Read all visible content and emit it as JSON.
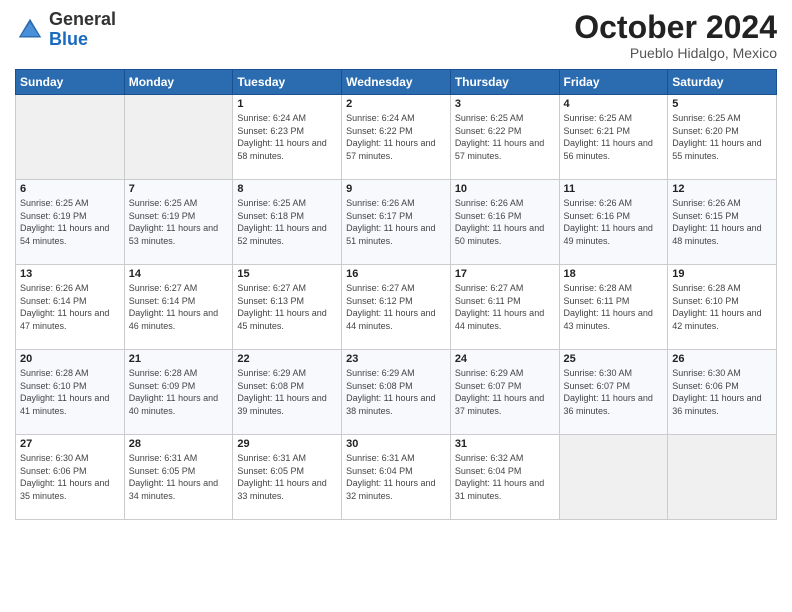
{
  "logo": {
    "general": "General",
    "blue": "Blue"
  },
  "header": {
    "month": "October 2024",
    "location": "Pueblo Hidalgo, Mexico"
  },
  "days_of_week": [
    "Sunday",
    "Monday",
    "Tuesday",
    "Wednesday",
    "Thursday",
    "Friday",
    "Saturday"
  ],
  "weeks": [
    [
      {
        "day": "",
        "info": ""
      },
      {
        "day": "",
        "info": ""
      },
      {
        "day": "1",
        "info": "Sunrise: 6:24 AM\nSunset: 6:23 PM\nDaylight: 11 hours and 58 minutes."
      },
      {
        "day": "2",
        "info": "Sunrise: 6:24 AM\nSunset: 6:22 PM\nDaylight: 11 hours and 57 minutes."
      },
      {
        "day": "3",
        "info": "Sunrise: 6:25 AM\nSunset: 6:22 PM\nDaylight: 11 hours and 57 minutes."
      },
      {
        "day": "4",
        "info": "Sunrise: 6:25 AM\nSunset: 6:21 PM\nDaylight: 11 hours and 56 minutes."
      },
      {
        "day": "5",
        "info": "Sunrise: 6:25 AM\nSunset: 6:20 PM\nDaylight: 11 hours and 55 minutes."
      }
    ],
    [
      {
        "day": "6",
        "info": "Sunrise: 6:25 AM\nSunset: 6:19 PM\nDaylight: 11 hours and 54 minutes."
      },
      {
        "day": "7",
        "info": "Sunrise: 6:25 AM\nSunset: 6:19 PM\nDaylight: 11 hours and 53 minutes."
      },
      {
        "day": "8",
        "info": "Sunrise: 6:25 AM\nSunset: 6:18 PM\nDaylight: 11 hours and 52 minutes."
      },
      {
        "day": "9",
        "info": "Sunrise: 6:26 AM\nSunset: 6:17 PM\nDaylight: 11 hours and 51 minutes."
      },
      {
        "day": "10",
        "info": "Sunrise: 6:26 AM\nSunset: 6:16 PM\nDaylight: 11 hours and 50 minutes."
      },
      {
        "day": "11",
        "info": "Sunrise: 6:26 AM\nSunset: 6:16 PM\nDaylight: 11 hours and 49 minutes."
      },
      {
        "day": "12",
        "info": "Sunrise: 6:26 AM\nSunset: 6:15 PM\nDaylight: 11 hours and 48 minutes."
      }
    ],
    [
      {
        "day": "13",
        "info": "Sunrise: 6:26 AM\nSunset: 6:14 PM\nDaylight: 11 hours and 47 minutes."
      },
      {
        "day": "14",
        "info": "Sunrise: 6:27 AM\nSunset: 6:14 PM\nDaylight: 11 hours and 46 minutes."
      },
      {
        "day": "15",
        "info": "Sunrise: 6:27 AM\nSunset: 6:13 PM\nDaylight: 11 hours and 45 minutes."
      },
      {
        "day": "16",
        "info": "Sunrise: 6:27 AM\nSunset: 6:12 PM\nDaylight: 11 hours and 44 minutes."
      },
      {
        "day": "17",
        "info": "Sunrise: 6:27 AM\nSunset: 6:11 PM\nDaylight: 11 hours and 44 minutes."
      },
      {
        "day": "18",
        "info": "Sunrise: 6:28 AM\nSunset: 6:11 PM\nDaylight: 11 hours and 43 minutes."
      },
      {
        "day": "19",
        "info": "Sunrise: 6:28 AM\nSunset: 6:10 PM\nDaylight: 11 hours and 42 minutes."
      }
    ],
    [
      {
        "day": "20",
        "info": "Sunrise: 6:28 AM\nSunset: 6:10 PM\nDaylight: 11 hours and 41 minutes."
      },
      {
        "day": "21",
        "info": "Sunrise: 6:28 AM\nSunset: 6:09 PM\nDaylight: 11 hours and 40 minutes."
      },
      {
        "day": "22",
        "info": "Sunrise: 6:29 AM\nSunset: 6:08 PM\nDaylight: 11 hours and 39 minutes."
      },
      {
        "day": "23",
        "info": "Sunrise: 6:29 AM\nSunset: 6:08 PM\nDaylight: 11 hours and 38 minutes."
      },
      {
        "day": "24",
        "info": "Sunrise: 6:29 AM\nSunset: 6:07 PM\nDaylight: 11 hours and 37 minutes."
      },
      {
        "day": "25",
        "info": "Sunrise: 6:30 AM\nSunset: 6:07 PM\nDaylight: 11 hours and 36 minutes."
      },
      {
        "day": "26",
        "info": "Sunrise: 6:30 AM\nSunset: 6:06 PM\nDaylight: 11 hours and 36 minutes."
      }
    ],
    [
      {
        "day": "27",
        "info": "Sunrise: 6:30 AM\nSunset: 6:06 PM\nDaylight: 11 hours and 35 minutes."
      },
      {
        "day": "28",
        "info": "Sunrise: 6:31 AM\nSunset: 6:05 PM\nDaylight: 11 hours and 34 minutes."
      },
      {
        "day": "29",
        "info": "Sunrise: 6:31 AM\nSunset: 6:05 PM\nDaylight: 11 hours and 33 minutes."
      },
      {
        "day": "30",
        "info": "Sunrise: 6:31 AM\nSunset: 6:04 PM\nDaylight: 11 hours and 32 minutes."
      },
      {
        "day": "31",
        "info": "Sunrise: 6:32 AM\nSunset: 6:04 PM\nDaylight: 11 hours and 31 minutes."
      },
      {
        "day": "",
        "info": ""
      },
      {
        "day": "",
        "info": ""
      }
    ]
  ]
}
